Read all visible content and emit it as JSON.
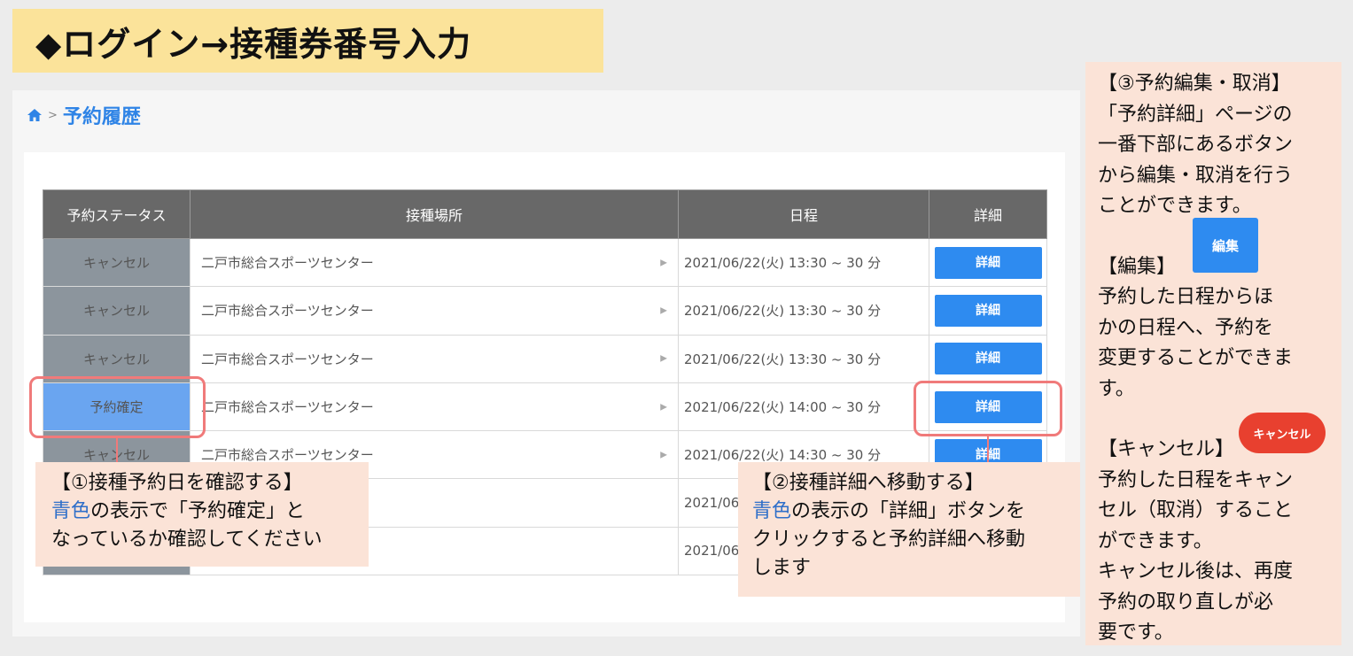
{
  "banner": {
    "title": "◆ログイン→接種券番号入力"
  },
  "breadcrumb": {
    "separator": ">",
    "title": "予約履歴"
  },
  "table": {
    "headers": [
      "予約ステータス",
      "接種場所",
      "日程",
      "詳細"
    ],
    "rows": [
      {
        "status": "キャンセル",
        "status_type": "cancel",
        "place": "二戸市総合スポーツセンター",
        "date": "2021/06/22(火) 13:30 ~ 30 分",
        "detail": "詳細"
      },
      {
        "status": "キャンセル",
        "status_type": "cancel",
        "place": "二戸市総合スポーツセンター",
        "date": "2021/06/22(火) 13:30 ~ 30 分",
        "detail": "詳細"
      },
      {
        "status": "キャンセル",
        "status_type": "cancel",
        "place": "二戸市総合スポーツセンター",
        "date": "2021/06/22(火) 13:30 ~ 30 分",
        "detail": "詳細"
      },
      {
        "status": "予約確定",
        "status_type": "confirmed",
        "place": "二戸市総合スポーツセンター",
        "date": "2021/06/22(火) 14:00 ~ 30 分",
        "detail": "詳細"
      },
      {
        "status": "キャンセル",
        "status_type": "cancel",
        "place": "二戸市総合スポーツセンター",
        "date": "2021/06/22(火) 14:30 ~ 30 分",
        "detail": "詳細"
      },
      {
        "status": "",
        "status_type": "cancel",
        "place": "",
        "date": "2021/06/",
        "detail": ""
      },
      {
        "status": "",
        "status_type": "cancel",
        "place": "",
        "date": "2021/06/",
        "detail": ""
      }
    ]
  },
  "note1": {
    "heading": "【①接種予約日を確認する】",
    "line2_blue": "青色",
    "line2_rest": "の表示で「予約確定」と",
    "line3": "なっているか確認してください"
  },
  "note2": {
    "heading": "【②接種詳細へ移動する】",
    "line2_blue": "青色",
    "line2_rest": "の表示の「詳細」ボタンを",
    "line3": "クリックすると予約詳細へ移動",
    "line4": "します"
  },
  "side_note": {
    "lines_top": [
      "【③予約編集・取消】",
      "「予約詳細」ページの",
      "一番下部にあるボタン",
      "から編集・取消を行う",
      "ことができます。"
    ],
    "edit_heading": "【編集】",
    "edit_lines": [
      "予約した日程からほ",
      "かの日程へ、予約を",
      "変更することができま",
      "す。"
    ],
    "cancel_heading": "【キャンセル】",
    "cancel_lines": [
      "予約した日程をキャン",
      "セル（取消）すること",
      "ができます。",
      "キャンセル後は、再度",
      "予約の取り直しが必",
      "要です。"
    ]
  },
  "buttons": {
    "edit": "編集",
    "cancel": "キャンセル"
  },
  "colors": {
    "accent_blue": "#2e8bf0",
    "cancel_red": "#e8402f",
    "highlight": "#f07a7a",
    "banner": "#fbe39a",
    "note_bg": "#fbe3d7"
  }
}
